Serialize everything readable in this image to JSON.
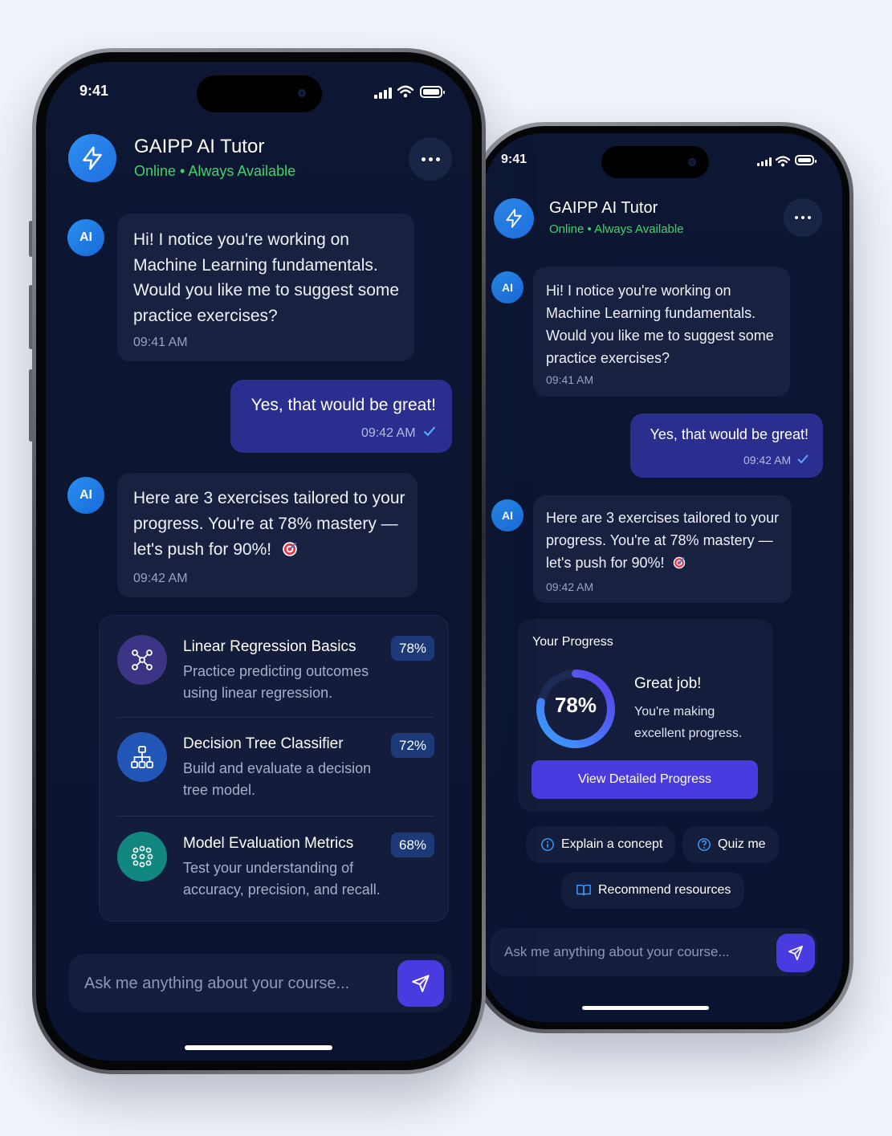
{
  "status_bar": {
    "time": "9:41"
  },
  "header": {
    "title": "GAIPP AI Tutor",
    "status": "Online • Always Available"
  },
  "ai_badge_label": "AI",
  "messages": [
    {
      "from": "ai",
      "text": "Hi! I notice you're working on Machine Learning fundamentals. Would you like me to suggest some practice exercises?",
      "time": "09:41 AM"
    },
    {
      "from": "user",
      "text": "Yes, that would be great!",
      "time": "09:42 AM"
    },
    {
      "from": "ai",
      "text": "Here are 3 exercises tailored to your progress. You're at 78% mastery — let's push for 90%!",
      "time": "09:42 AM"
    }
  ],
  "exercises": [
    {
      "title": "Linear Regression Basics",
      "desc": "Practice predicting outcomes using linear regression.",
      "pct": "78%",
      "icon": "nodes-icon",
      "color": "#3c3585"
    },
    {
      "title": "Decision Tree Classifier",
      "desc": "Build and evaluate a decision tree model.",
      "pct": "72%",
      "icon": "tree-icon",
      "color": "#2257b8"
    },
    {
      "title": "Model Evaluation Metrics",
      "desc": "Test your understanding of accuracy, precision, and recall.",
      "pct": "68%",
      "icon": "dots-grid-icon",
      "color": "#11877f"
    }
  ],
  "progress": {
    "heading": "Your Progress",
    "value_label": "78%",
    "value": 0.78,
    "great": "Great job!",
    "sub": "You're making excellent progress.",
    "cta": "View Detailed Progress"
  },
  "quick_actions": [
    {
      "label": "Explain a concept",
      "icon": "info-icon"
    },
    {
      "label": "Quiz me",
      "icon": "question-icon"
    },
    {
      "label": "Recommend resources",
      "icon": "book-icon"
    }
  ],
  "input": {
    "placeholder": "Ask me anything about your course..."
  },
  "colors": {
    "accent": "#4a3be0",
    "online": "#3ed46a",
    "user_bubble": "#2a2e8e",
    "ai_bubble": "#18213f"
  }
}
